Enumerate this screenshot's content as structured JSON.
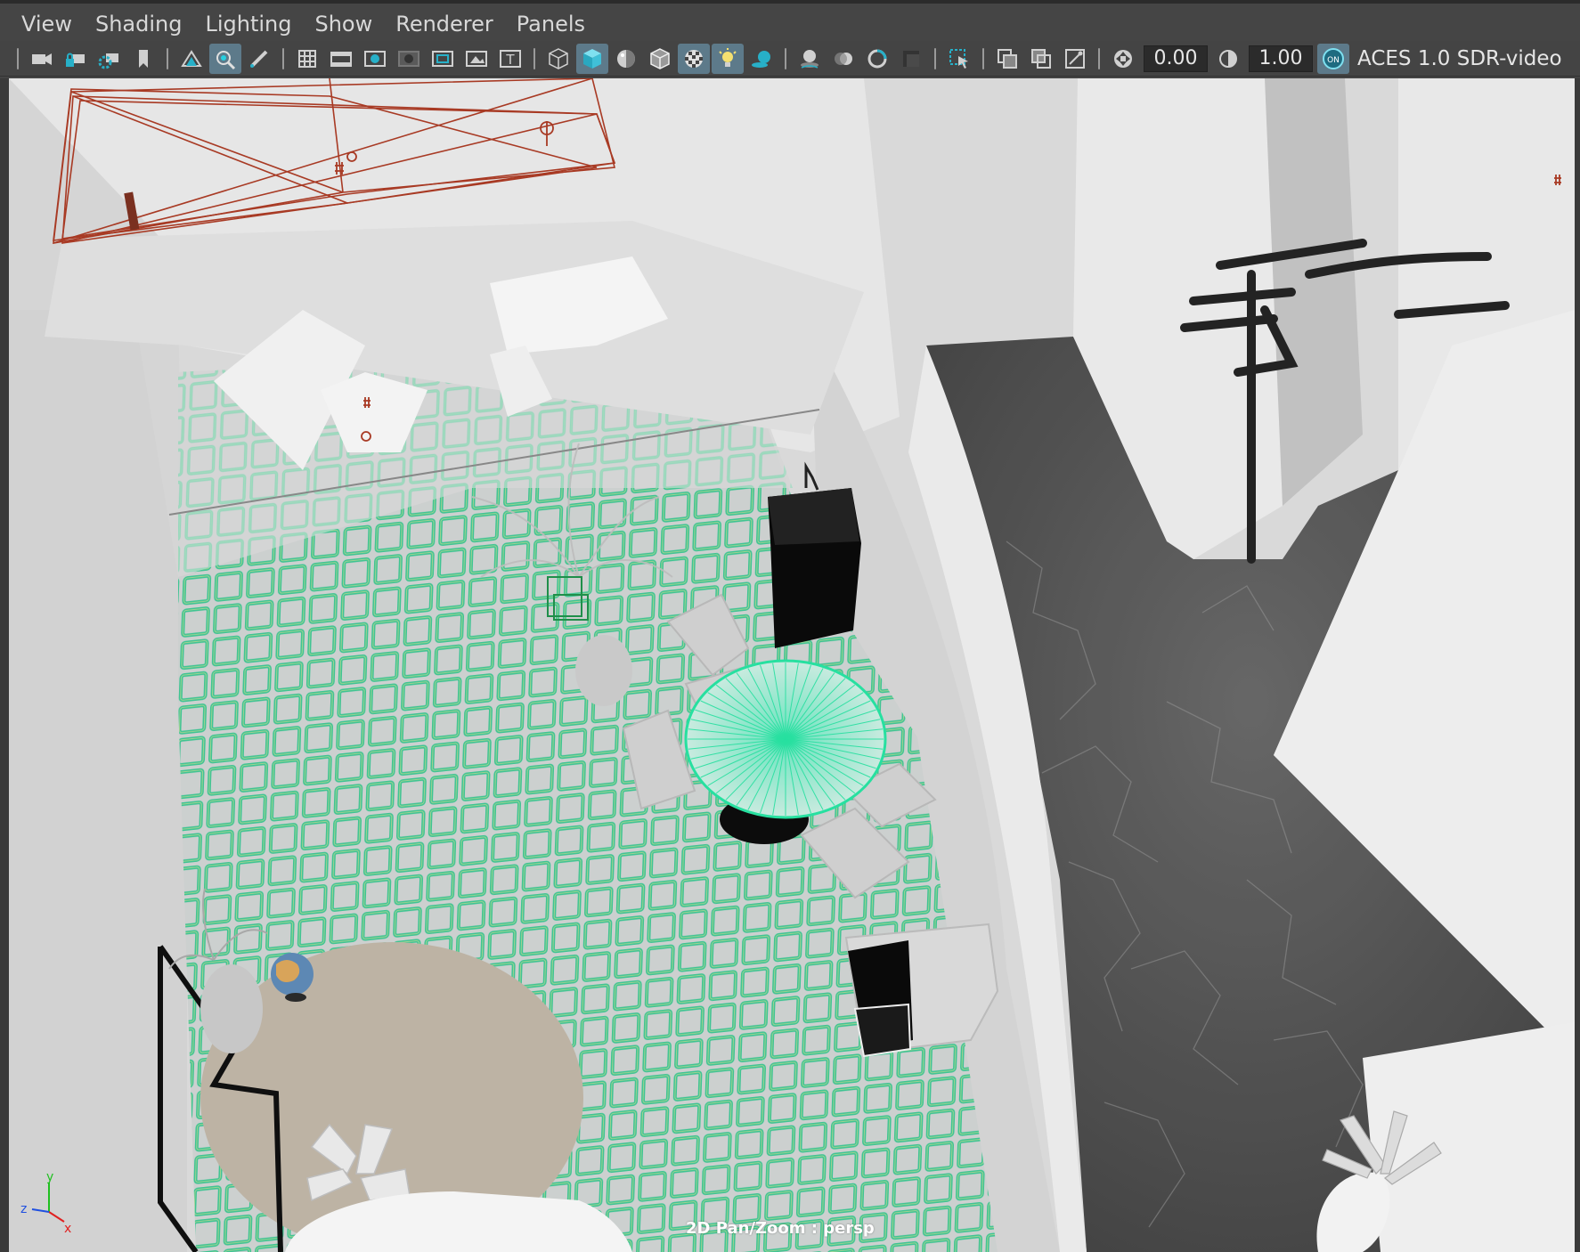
{
  "menubar": {
    "items": [
      "View",
      "Shading",
      "Lighting",
      "Show",
      "Renderer",
      "Panels"
    ]
  },
  "toolbar": {
    "icons": [
      "camera-icon",
      "lock-camera-icon",
      "camera-attributes-icon",
      "bookmark-icon",
      "image-plane-icon",
      "2d-pan-zoom-icon",
      "grease-pencil-icon",
      "grid-icon",
      "film-gate-icon",
      "resolution-gate-icon",
      "gate-mask-icon",
      "field-chart-icon",
      "safe-action-icon",
      "safe-title-icon",
      "wireframe-icon",
      "smooth-shade-icon",
      "default-material-icon",
      "wireframe-on-shaded-icon",
      "textured-icon",
      "use-all-lights-icon",
      "shadows-icon",
      "screen-space-ao-icon",
      "motion-blur-icon",
      "anti-aliasing-icon",
      "depth-of-field-icon",
      "isolate-select-icon",
      "xray-icon",
      "xray-active-components-icon",
      "xray-joints-icon",
      "exposure-icon",
      "gamma-icon",
      "color-management-icon"
    ],
    "exposure_value": "0.00",
    "gamma_value": "1.00",
    "color_management_label": "ON",
    "color_space": "ACES 1.0 SDR-video"
  },
  "viewport": {
    "hud_label": "2D Pan/Zoom : persp",
    "axis": {
      "x": "x",
      "y": "y",
      "z": "z"
    },
    "colors": {
      "selection": "#27e0a0",
      "light_manip": "#b03a20",
      "axis_x": "#e02020",
      "axis_y": "#20c020",
      "axis_z": "#2050e0"
    }
  }
}
